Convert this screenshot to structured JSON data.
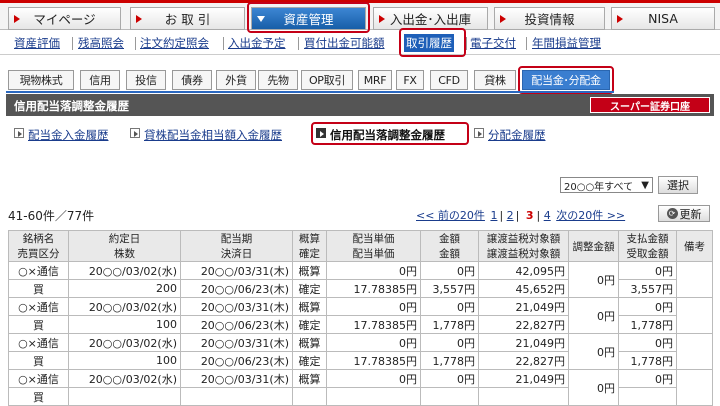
{
  "main_nav": [
    {
      "label": "マイページ",
      "active": false
    },
    {
      "label": "お 取 引",
      "active": false
    },
    {
      "label": "資産管理",
      "active": true
    },
    {
      "label": "入出金･入出庫",
      "active": false
    },
    {
      "label": "投資情報",
      "active": false
    },
    {
      "label": "NISA",
      "active": false
    }
  ],
  "sub_nav": [
    "資産評価",
    "残高照会",
    "注文約定照会",
    "入出金予定",
    "買付出金可能額",
    "取引履歴",
    "電子交付",
    "年間損益管理"
  ],
  "sub_nav_active": "取引履歴",
  "product_tabs": [
    "現物株式",
    "信用",
    "投信",
    "債券",
    "外貨",
    "先物",
    "OP取引",
    "MRF",
    "FX",
    "CFD",
    "貸株",
    "配当金･分配金"
  ],
  "product_tab_active": "配当金･分配金",
  "section_title": "信用配当落調整金履歴",
  "logo_text": "スーパー証券口座",
  "history_links": [
    {
      "label": "配当金入金履歴",
      "current": false
    },
    {
      "label": "貸株配当金相当額入金履歴",
      "current": false
    },
    {
      "label": "信用配当落調整金履歴",
      "current": true
    },
    {
      "label": "分配金履歴",
      "current": false
    }
  ],
  "year_select": {
    "value": "20○○年すべて",
    "arrow": "▼"
  },
  "select_button": "選択",
  "result_count": "41-60件／77件",
  "pager": {
    "prev": "<< 前の20件",
    "pages": [
      "1",
      "2",
      "3",
      "4"
    ],
    "current": "3",
    "next": "次の20件 >>"
  },
  "refresh_button": "更新",
  "refresh_icon": "refresh-icon",
  "table": {
    "headers": {
      "col1": [
        "銘柄名",
        "売買区分"
      ],
      "col2": [
        "約定日",
        "株数"
      ],
      "col3": [
        "配当期",
        "決済日"
      ],
      "col4": [
        "概算",
        "確定"
      ],
      "col5": [
        "配当単価",
        "配当単価"
      ],
      "col6": [
        "金額",
        "金額"
      ],
      "col7": [
        "譲渡益税対象額",
        "譲渡益税対象額"
      ],
      "col8": "調整金額",
      "col9": [
        "支払金額",
        "受取金額"
      ],
      "col10": "備考"
    },
    "rows": [
      {
        "name": "○×通信",
        "side": "買",
        "trade_date": "20○○/03/02(水)",
        "shares": "200",
        "period": "20○○/03/31(木)",
        "settle": "20○○/06/23(木)",
        "est": "概算",
        "conf": "確定",
        "price_est": "0円",
        "price_conf": "17.78385円",
        "amt_est": "0円",
        "amt_conf": "3,557円",
        "tax_est": "42,095円",
        "tax_conf": "45,652円",
        "adj": "0円",
        "pay": "0円",
        "recv": "3,557円",
        "note": ""
      },
      {
        "name": "○×通信",
        "side": "買",
        "trade_date": "20○○/03/02(水)",
        "shares": "100",
        "period": "20○○/03/31(木)",
        "settle": "20○○/06/23(木)",
        "est": "概算",
        "conf": "確定",
        "price_est": "0円",
        "price_conf": "17.78385円",
        "amt_est": "0円",
        "amt_conf": "1,778円",
        "tax_est": "21,049円",
        "tax_conf": "22,827円",
        "adj": "0円",
        "pay": "0円",
        "recv": "1,778円",
        "note": ""
      },
      {
        "name": "○×通信",
        "side": "買",
        "trade_date": "20○○/03/02(水)",
        "shares": "100",
        "period": "20○○/03/31(木)",
        "settle": "20○○/06/23(木)",
        "est": "概算",
        "conf": "確定",
        "price_est": "0円",
        "price_conf": "17.78385円",
        "amt_est": "0円",
        "amt_conf": "1,778円",
        "tax_est": "21,049円",
        "tax_conf": "22,827円",
        "adj": "0円",
        "pay": "0円",
        "recv": "1,778円",
        "note": ""
      },
      {
        "name": "○×通信",
        "side": "買",
        "trade_date": "20○○/03/02(水)",
        "shares": "",
        "period": "20○○/03/31(木)",
        "settle": "",
        "est": "概算",
        "conf": "",
        "price_est": "0円",
        "price_conf": "",
        "amt_est": "0円",
        "amt_conf": "",
        "tax_est": "21,049円",
        "tax_conf": "",
        "adj": "0円",
        "pay": "0円",
        "recv": "",
        "note": ""
      }
    ]
  },
  "colors": {
    "brand_red": "#c40017",
    "active_blue": "#1e5fb8",
    "title_bar": "#555555"
  }
}
